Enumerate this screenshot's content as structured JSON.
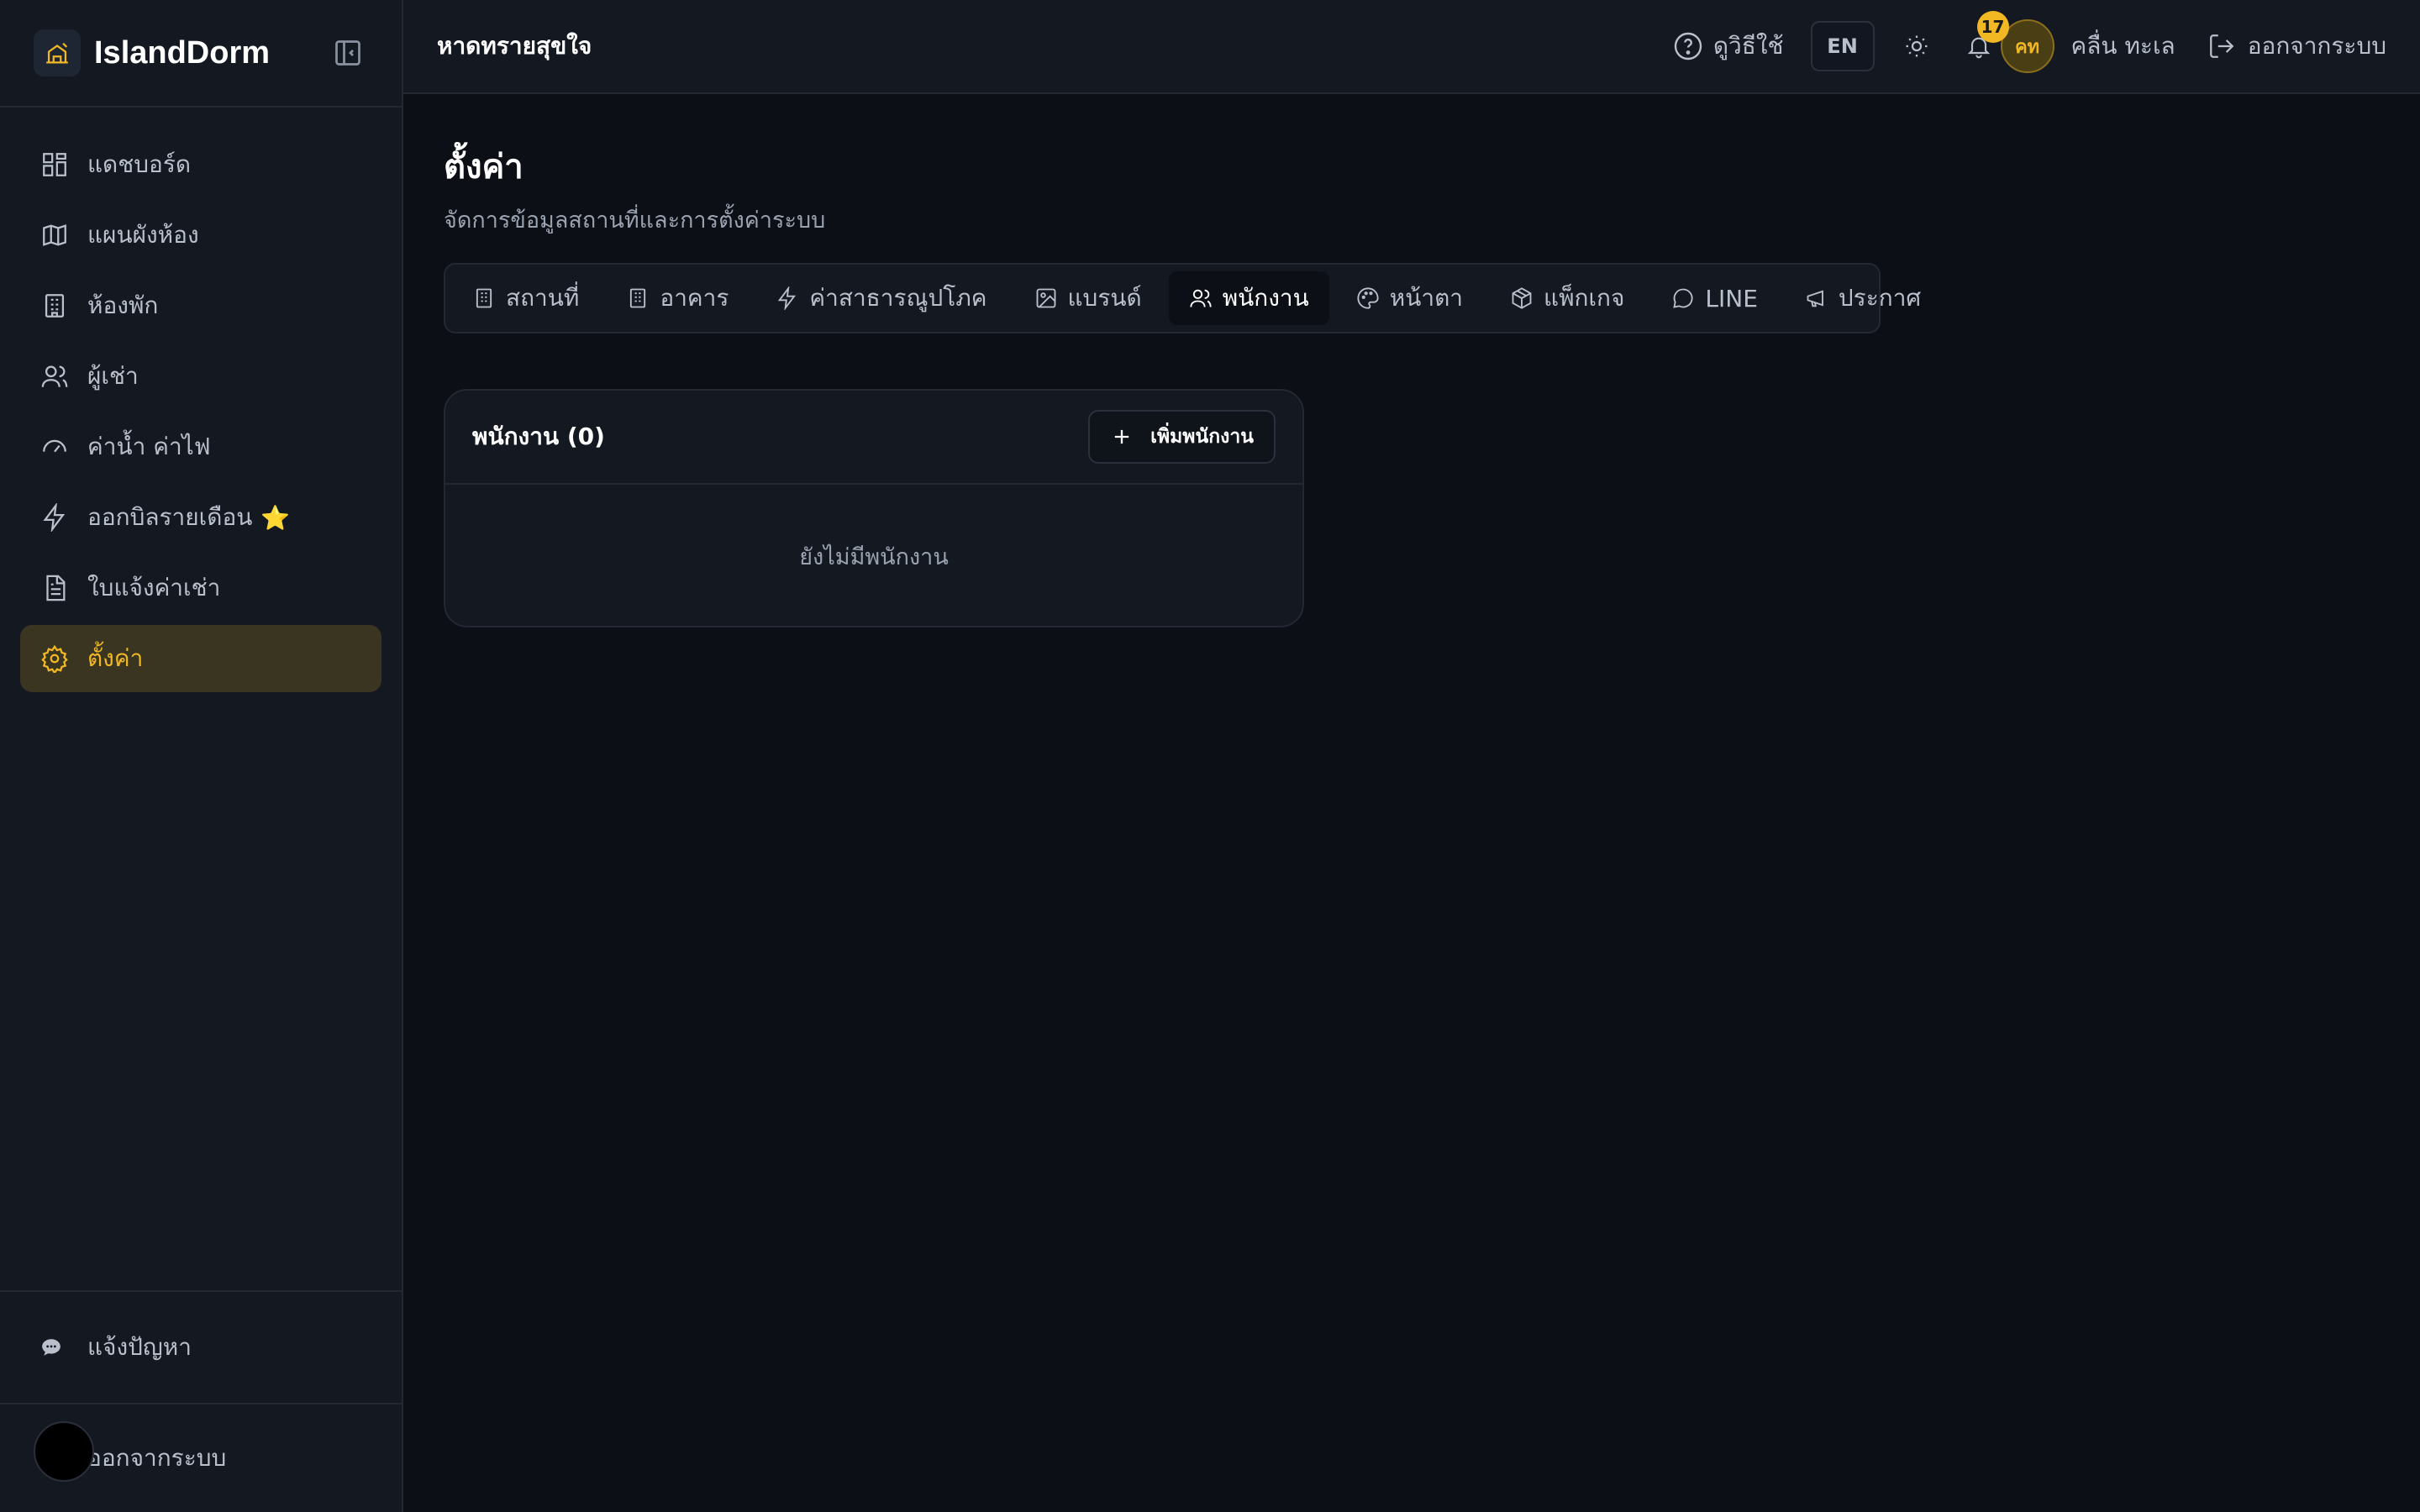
{
  "brand": {
    "name": "IslandDorm"
  },
  "sidebar": {
    "items": [
      {
        "label": "แดชบอร์ด",
        "icon": "dashboard-icon"
      },
      {
        "label": "แผนผังห้อง",
        "icon": "map-icon"
      },
      {
        "label": "ห้องพัก",
        "icon": "building-icon"
      },
      {
        "label": "ผู้เช่า",
        "icon": "users-icon"
      },
      {
        "label": "ค่าน้ำ ค่าไฟ",
        "icon": "gauge-icon"
      },
      {
        "label": "ออกบิลรายเดือน",
        "icon": "lightning-icon",
        "star": "⭐"
      },
      {
        "label": "ใบแจ้งค่าเช่า",
        "icon": "document-icon"
      },
      {
        "label": "ตั้งค่า",
        "icon": "gear-icon",
        "active": true
      }
    ],
    "report_label": "แจ้งปัญหา",
    "logout_label": "ออกจากระบบ"
  },
  "topbar": {
    "location": "หาดทรายสุขใจ",
    "help_label": "ดูวิธีใช้",
    "lang": "EN",
    "notification_count": "17",
    "avatar_initials": "คท",
    "user_name": "คลื่น ทะเล",
    "logout_label": "ออกจากระบบ"
  },
  "page": {
    "title": "ตั้งค่า",
    "subtitle": "จัดการข้อมูลสถานที่และการตั้งค่าระบบ"
  },
  "tabs": [
    {
      "label": "สถานที่",
      "icon": "building-icon"
    },
    {
      "label": "อาคาร",
      "icon": "building-icon"
    },
    {
      "label": "ค่าสาธารณูปโภค",
      "icon": "lightning-icon"
    },
    {
      "label": "แบรนด์",
      "icon": "image-icon"
    },
    {
      "label": "พนักงาน",
      "icon": "users-icon",
      "active": true
    },
    {
      "label": "หน้าตา",
      "icon": "palette-icon"
    },
    {
      "label": "แพ็กเกจ",
      "icon": "package-icon"
    },
    {
      "label": "LINE",
      "icon": "chat-icon"
    },
    {
      "label": "ประกาศ",
      "icon": "megaphone-icon"
    }
  ],
  "staff_card": {
    "title": "พนักงาน (0)",
    "add_label": "เพิ่มพนักงาน",
    "empty_text": "ยังไม่มีพนักงาน"
  },
  "colors": {
    "accent": "#f2b824",
    "background": "#0c0f15",
    "panel": "#141821"
  }
}
